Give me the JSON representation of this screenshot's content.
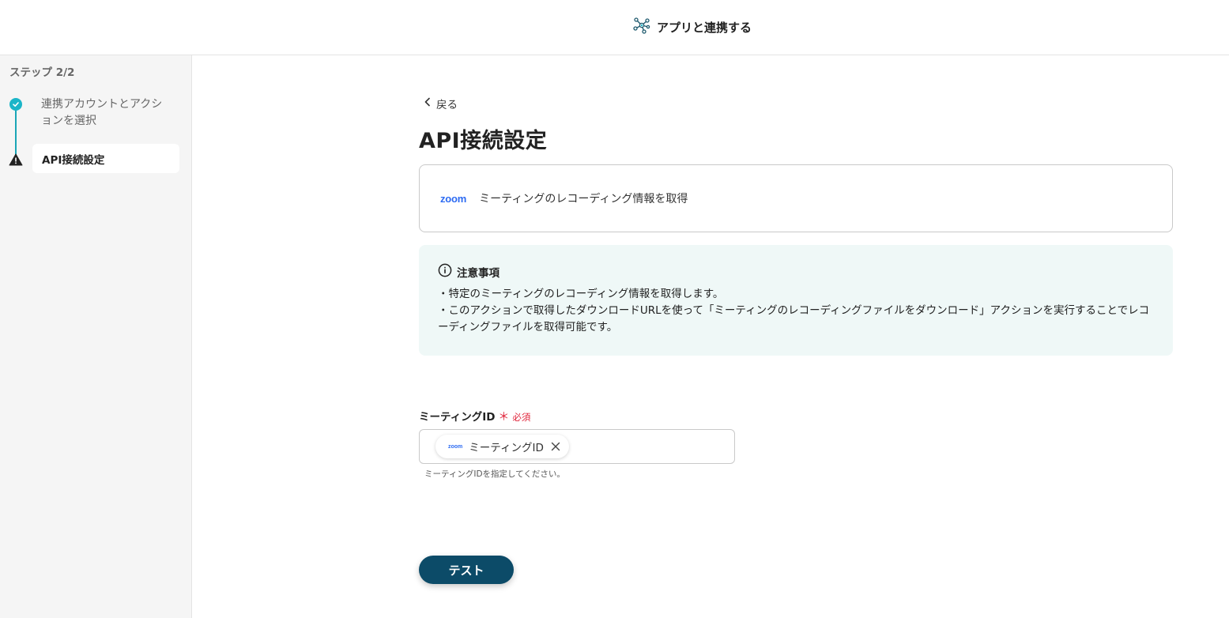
{
  "header": {
    "title": "アプリと連携する",
    "icon": "network-nodes-icon"
  },
  "sidebar": {
    "step_counter": "ステップ 2/2",
    "steps": [
      {
        "label": "連携アカウントとアクションを選択",
        "status": "completed"
      },
      {
        "label": "API接続設定",
        "status": "warning"
      }
    ]
  },
  "main": {
    "back_label": "戻る",
    "title": "API接続設定",
    "action": {
      "app_logo": "zoom",
      "label": "ミーティングのレコーディング情報を取得"
    },
    "notice": {
      "heading": "注意事項",
      "lines": [
        "・特定のミーティングのレコーディング情報を取得します。",
        "・このアクションで取得したダウンロードURLを使って「ミーティングのレコーディングファイルをダウンロード」アクションを実行することでレコーディングファイルを取得可能です。"
      ]
    },
    "field": {
      "label": "ミーティングID",
      "required_mark": "＊",
      "required_text": "必須",
      "chip": {
        "app_logo": "zoom",
        "label": "ミーティングID"
      },
      "hint": "ミーティングIDを指定してください。"
    },
    "test_button": "テスト"
  },
  "colors": {
    "accent": "#1bb5c8",
    "primary_button": "#0c4b68",
    "required": "#e0243a",
    "notice_bg": "#eff8f7",
    "zoom_blue": "#2d6bf2"
  }
}
